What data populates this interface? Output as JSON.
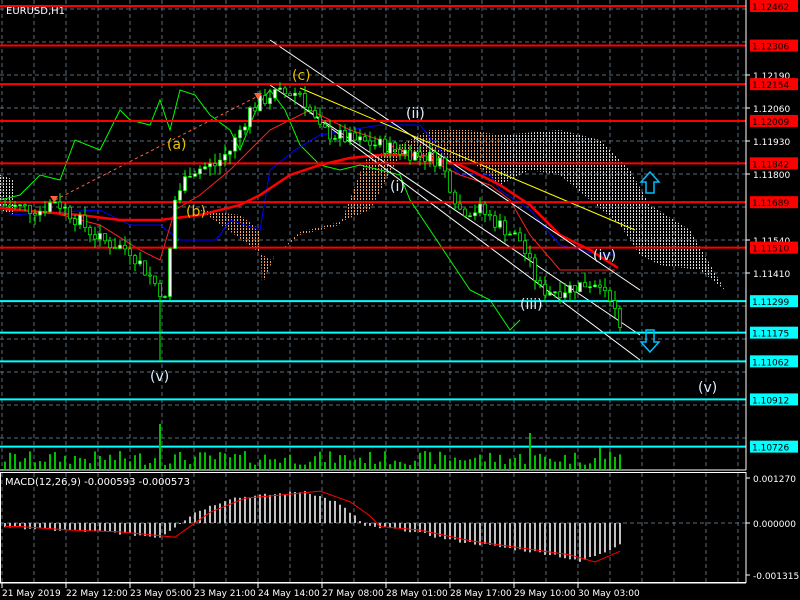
{
  "chart_data": {
    "type": "candlestick",
    "title": "EURUSD,H1",
    "symbol": "EURUSD",
    "timeframe": "H1",
    "y_axis_ticks": [
      "1.12190",
      "1.12060",
      "1.11930",
      "1.11800",
      "1.11540",
      "1.11410"
    ],
    "ylim": [
      1.1065,
      1.1248
    ],
    "x_tick_labels": [
      "21 May 2019",
      "22 May 12:00",
      "23 May 05:00",
      "23 May 21:00",
      "24 May 14:00",
      "27 May 08:00",
      "28 May 01:00",
      "28 May 17:00",
      "29 May 10:00",
      "30 May 03:00"
    ],
    "resistance_levels": [
      {
        "label": "1.12462",
        "price": 1.12462
      },
      {
        "label": "1.12306",
        "price": 1.12306
      },
      {
        "label": "1.12154",
        "price": 1.12154
      },
      {
        "label": "1.12009",
        "price": 1.12009
      },
      {
        "label": "1.11842",
        "price": 1.11842
      },
      {
        "label": "1.11689",
        "price": 1.11689
      },
      {
        "label": "1.11510",
        "price": 1.1151
      }
    ],
    "support_levels": [
      {
        "label": "1.11299",
        "price": 1.11299
      },
      {
        "label": "1.11175",
        "price": 1.11175
      },
      {
        "label": "1.11062",
        "price": 1.11062
      },
      {
        "label": "1.10912",
        "price": 1.10912
      },
      {
        "label": "1.10726",
        "price": 1.10726
      }
    ],
    "price_keypoints": [
      [
        0,
        1.11678
      ],
      [
        7,
        1.11658
      ],
      [
        10,
        1.11698
      ],
      [
        19,
        1.1154
      ],
      [
        25,
        1.11501
      ],
      [
        31,
        1.11343
      ],
      [
        32,
        1.113
      ],
      [
        34,
        1.11698
      ],
      [
        37,
        1.11816
      ],
      [
        42,
        1.11835
      ],
      [
        45,
        1.11894
      ],
      [
        49,
        1.12052
      ],
      [
        53,
        1.12111
      ],
      [
        59,
        1.12123
      ],
      [
        63,
        1.11973
      ],
      [
        69,
        1.11934
      ],
      [
        75,
        1.11914
      ],
      [
        79,
        1.11894
      ],
      [
        83,
        1.11875
      ],
      [
        87,
        1.11855
      ],
      [
        91,
        1.1166
      ],
      [
        95,
        1.11658
      ],
      [
        99,
        1.11599
      ],
      [
        103,
        1.1154
      ],
      [
        107,
        1.11343
      ],
      [
        111,
        1.11343
      ],
      [
        115,
        1.11363
      ],
      [
        119,
        1.11382
      ],
      [
        121,
        1.11323
      ],
      [
        123,
        1.11185
      ]
    ],
    "wave_labels": [
      "(a)",
      "(b)",
      "(c)",
      "(i)",
      "(ii)",
      "(iii)",
      "(iv)",
      "(v)",
      "(v)"
    ],
    "macd": {
      "label": "MACD(12,26,9) -0.000593 -0.000573",
      "y_ticks": [
        "0.001270",
        "0.000000",
        "-0.001315"
      ],
      "ylim": [
        -0.001315,
        0.00127
      ],
      "histogram_keypoints": [
        [
          0,
          -0.0001
        ],
        [
          10,
          -0.0002
        ],
        [
          20,
          -0.00025
        ],
        [
          31,
          -0.0004
        ],
        [
          34,
          -0.0001
        ],
        [
          38,
          0.0003
        ],
        [
          45,
          0.0007
        ],
        [
          53,
          0.0008
        ],
        [
          60,
          0.0009
        ],
        [
          66,
          0.0006
        ],
        [
          70,
          0.0002
        ],
        [
          72,
          -0.0001
        ],
        [
          80,
          -0.0002
        ],
        [
          90,
          -0.0005
        ],
        [
          100,
          -0.0007
        ],
        [
          110,
          -0.0009
        ],
        [
          115,
          -0.0011
        ],
        [
          120,
          -0.0008
        ],
        [
          123,
          -0.000593
        ]
      ],
      "signal_last": -0.000573
    },
    "colors": {
      "resistance": "#ff0000",
      "support": "#00ffff",
      "candle": "#00ff00",
      "ma": "#ff0000",
      "kijun": "#0000ff",
      "channel": "#ffffff",
      "trend": "#ffff00",
      "cloud": "#f4a460"
    }
  }
}
